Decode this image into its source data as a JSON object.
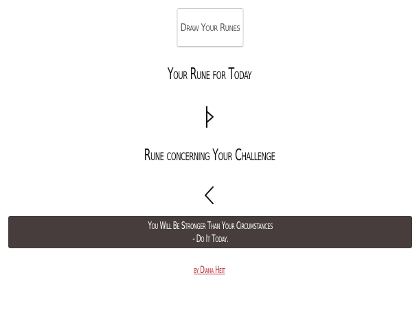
{
  "header": {
    "draw_button_label": "Draw Your Runes"
  },
  "today": {
    "heading": "Your Rune for Today",
    "rune_glyph": "ᚦ",
    "rune_icon": "thurisaz-rune-icon"
  },
  "challenge": {
    "heading": "Rune concerning Your Challenge",
    "rune_glyph": "ᚲ",
    "rune_icon": "kaunan-rune-icon"
  },
  "message": {
    "line1": "You Will Be Stronger Than Your Circumstances",
    "line2": "- Do It Today."
  },
  "footer": {
    "author_link": "by Diana Heit"
  },
  "colors": {
    "message_background": "#473d3d",
    "link": "#b3272d"
  }
}
